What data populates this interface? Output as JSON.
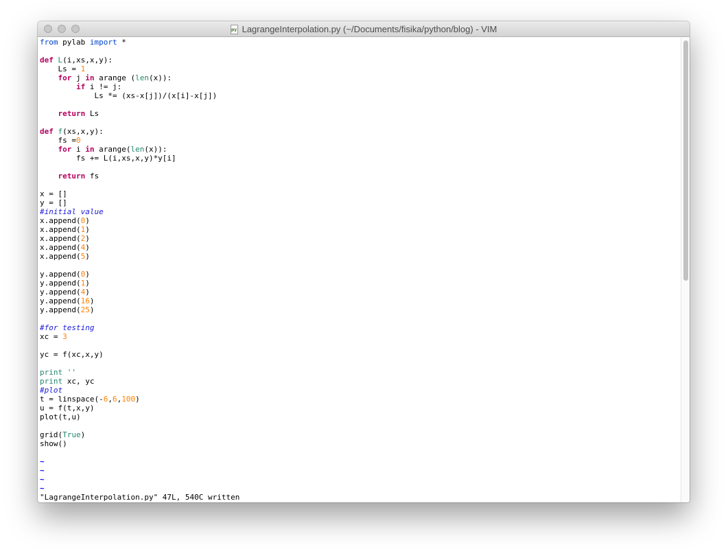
{
  "window": {
    "title": "LagrangeInterpolation.py (~/Documents/fisika/python/blog) - VIM",
    "file_icon_text": "py"
  },
  "colors": {
    "keyword": "#b5005e",
    "import": "#0044cc",
    "number": "#ff8000",
    "builtin": "#23866e",
    "comment": "#1a1ad6",
    "tilde": "#0000ff"
  },
  "editor": {
    "lines": {
      "l1": {
        "a": "from",
        "b": " pylab ",
        "c": "import",
        "d": " *"
      },
      "l3": {
        "a": "def",
        "b": " ",
        "c": "L",
        "d": "(i,xs,x,y):"
      },
      "l4": {
        "a": "    Ls = ",
        "b": "1"
      },
      "l5": {
        "a": "    ",
        "b": "for",
        "c": " j ",
        "d": "in",
        "e": " arange (",
        "f": "len",
        "g": "(x)):"
      },
      "l6": {
        "a": "        ",
        "b": "if",
        "c": " i != j:"
      },
      "l7": {
        "a": "            Ls *= (xs-x[j])/(x[i]-x[j])"
      },
      "l9": {
        "a": "    ",
        "b": "return",
        "c": " Ls"
      },
      "l11": {
        "a": "def",
        "b": " ",
        "c": "f",
        "d": "(xs,x,y):"
      },
      "l12": {
        "a": "    fs =",
        "b": "0"
      },
      "l13": {
        "a": "    ",
        "b": "for",
        "c": " i ",
        "d": "in",
        "e": " arange(",
        "f": "len",
        "g": "(x)):"
      },
      "l14": {
        "a": "        fs += L(i,xs,x,y)*y[i]"
      },
      "l16": {
        "a": "    ",
        "b": "return",
        "c": " fs"
      },
      "l18": {
        "a": "x = []"
      },
      "l19": {
        "a": "y = []"
      },
      "l20": {
        "a": "#initial value"
      },
      "l21": {
        "a": "x.append(",
        "b": "0",
        "c": ")"
      },
      "l22": {
        "a": "x.append(",
        "b": "1",
        "c": ")"
      },
      "l23": {
        "a": "x.append(",
        "b": "2",
        "c": ")"
      },
      "l24": {
        "a": "x.append(",
        "b": "4",
        "c": ")"
      },
      "l25": {
        "a": "x.append(",
        "b": "5",
        "c": ")"
      },
      "l27": {
        "a": "y.append(",
        "b": "0",
        "c": ")"
      },
      "l28": {
        "a": "y.append(",
        "b": "1",
        "c": ")"
      },
      "l29": {
        "a": "y.append(",
        "b": "4",
        "c": ")"
      },
      "l30": {
        "a": "y.append(",
        "b": "16",
        "c": ")"
      },
      "l31": {
        "a": "y.append(",
        "b": "25",
        "c": ")"
      },
      "l33": {
        "a": "#for testing"
      },
      "l34": {
        "a": "xc = ",
        "b": "3"
      },
      "l36": {
        "a": "yc = f(xc,x,y)"
      },
      "l38": {
        "a": "print",
        "b": " ",
        "c": "''"
      },
      "l39": {
        "a": "print",
        "b": " xc, yc"
      },
      "l40": {
        "a": "#plot"
      },
      "l41": {
        "a": "t = linspace(-",
        "b": "6",
        "c": ",",
        "d": "6",
        "e": ",",
        "f": "100",
        "g": ")"
      },
      "l42": {
        "a": "u = f(t,x,y)"
      },
      "l43": {
        "a": "plot(t,u)"
      },
      "l45": {
        "a": "grid(",
        "b": "True",
        "c": ")"
      },
      "l46": {
        "a": "show()"
      }
    },
    "tilde": "~",
    "status_message": "\"LagrangeInterpolation.py\" 47L, 540C written"
  }
}
